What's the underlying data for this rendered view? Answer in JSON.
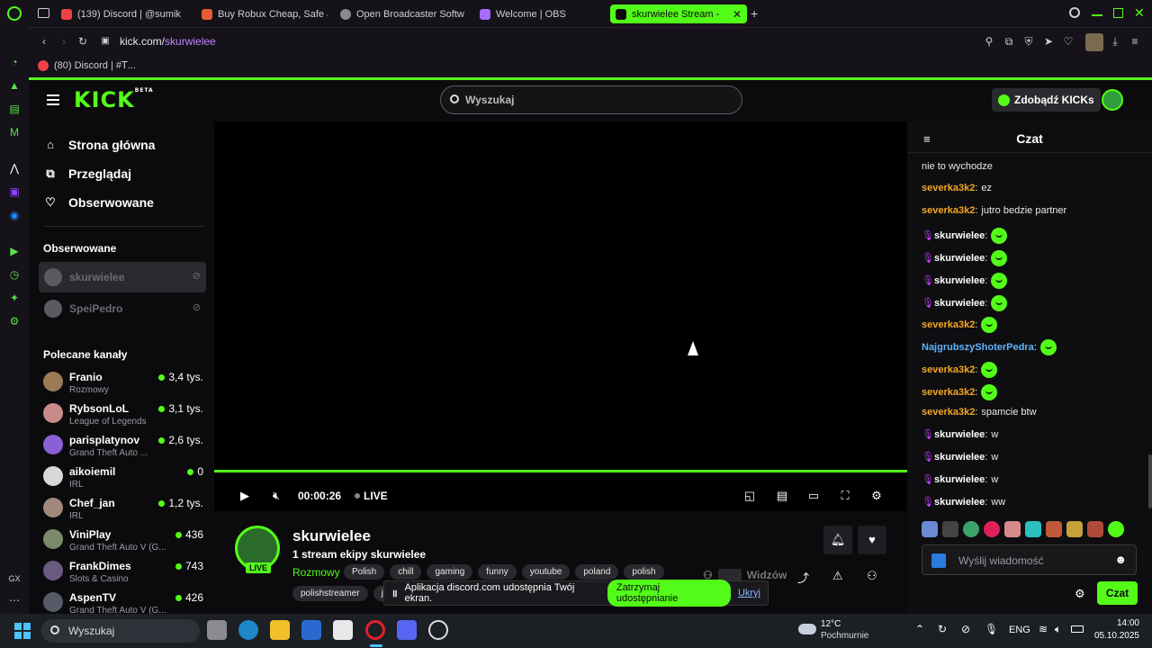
{
  "browser": {
    "tabs": [
      {
        "label": "(139) Discord | @sumik",
        "color": "#ed4245"
      },
      {
        "label": "Buy Robux Cheap, Safe &",
        "color": "#e65c2e"
      },
      {
        "label": "Open Broadcaster Softw",
        "color": "#8a8a8a"
      },
      {
        "label": "Welcome | OBS",
        "color": "#a96cff"
      },
      {
        "label": "skurwielee Stream -",
        "color": "#53fc18"
      }
    ],
    "new_tab": "+",
    "address": {
      "host": "kick.com/",
      "path": "skurwielee"
    },
    "bookmark": "(80) Discord | #ꓔ..."
  },
  "kick": {
    "logo": "KICK",
    "logo_badge": "BETA",
    "search_placeholder": "Wyszukaj",
    "get_kicks": "Zdobądź KICKs"
  },
  "sidebar": {
    "nav": [
      {
        "label": "Strona główna",
        "icon": "home-icon"
      },
      {
        "label": "Przeglądaj",
        "icon": "browse-icon"
      },
      {
        "label": "Obserwowane",
        "icon": "heart-icon"
      }
    ],
    "followed_title": "Obserwowane",
    "followed": [
      {
        "name": "skurwielee"
      },
      {
        "name": "SpeiPedro"
      }
    ],
    "recommended_title": "Polecane kanały",
    "recommended": [
      {
        "name": "Franio",
        "category": "Rozmowy",
        "viewers": "3,4 tys."
      },
      {
        "name": "RybsonLoL",
        "category": "League of Legends",
        "viewers": "3,1 tys."
      },
      {
        "name": "parisplatynov",
        "category": "Grand Theft Auto ...",
        "viewers": "2,6 tys."
      },
      {
        "name": "aikoiemil",
        "category": "IRL",
        "viewers": "0"
      },
      {
        "name": "Chef_jan",
        "category": "IRL",
        "viewers": "1,2 tys."
      },
      {
        "name": "ViniPlay",
        "category": "Grand Theft Auto V (G...",
        "viewers": "436"
      },
      {
        "name": "FrankDimes",
        "category": "Slots & Casino",
        "viewers": "743"
      },
      {
        "name": "AspenTV",
        "category": "Grand Theft Auto V (G...",
        "viewers": "426"
      }
    ]
  },
  "player": {
    "time": "00:00:26",
    "live": "LIVE"
  },
  "stream": {
    "streamer": "skurwielee",
    "live_badge": "LIVE",
    "title": "1 stream ekipy skurwielee",
    "category": "Rozmowy",
    "tags": [
      "Polish",
      "chill",
      "gaming",
      "funny",
      "youtube",
      "poland",
      "polish"
    ],
    "tags_row2": [
      "polishstreamer",
      "ju"
    ],
    "viewers_label": "Widzów"
  },
  "share_banner": {
    "text": "Aplikacja discord.com udostępnia Twój ekran.",
    "stop": "Zatrzymaj udostępnianie",
    "hide": "Ukryj"
  },
  "chat": {
    "title": "Czat",
    "top_line": "nie to wychodze",
    "messages": [
      {
        "user": "severka3k2",
        "color": "#f5a623",
        "text": "ez",
        "emote": false,
        "mic": false
      },
      {
        "user": "severka3k2",
        "color": "#f5a623",
        "text": "jutro bedzie partner",
        "emote": false,
        "mic": false
      },
      {
        "user": "skurwielee",
        "color": "#ffffff",
        "text": "",
        "emote": true,
        "mic": true
      },
      {
        "user": "skurwielee",
        "color": "#ffffff",
        "text": "",
        "emote": true,
        "mic": true
      },
      {
        "user": "skurwielee",
        "color": "#ffffff",
        "text": "",
        "emote": true,
        "mic": true
      },
      {
        "user": "skurwielee",
        "color": "#ffffff",
        "text": "",
        "emote": true,
        "mic": true
      },
      {
        "user": "severka3k2",
        "color": "#f5a623",
        "text": "",
        "emote": true,
        "mic": false
      },
      {
        "user": "NajgrubszyShoterPedra",
        "color": "#5fb3ff",
        "text": "",
        "emote": true,
        "mic": false
      },
      {
        "user": "severka3k2",
        "color": "#f5a623",
        "text": "",
        "emote": true,
        "mic": false
      },
      {
        "user": "severka3k2",
        "color": "#f5a623",
        "text": "",
        "emote": true,
        "mic": false
      },
      {
        "user": "severka3k2",
        "color": "#f5a623",
        "text": "spamcie btw",
        "emote": false,
        "mic": false
      },
      {
        "user": "skurwielee",
        "color": "#ffffff",
        "text": "w",
        "emote": false,
        "mic": true
      },
      {
        "user": "skurwielee",
        "color": "#ffffff",
        "text": "w",
        "emote": false,
        "mic": true
      },
      {
        "user": "skurwielee",
        "color": "#ffffff",
        "text": "w",
        "emote": false,
        "mic": true
      },
      {
        "user": "skurwielee",
        "color": "#ffffff",
        "text": "ww",
        "emote": false,
        "mic": true
      }
    ],
    "input_placeholder": "Wyślij wiadomość",
    "send_label": "Czat"
  },
  "taskbar": {
    "search": "Wyszukaj",
    "weather_temp": "12°C",
    "weather_desc": "Pochmurnie",
    "lang": "ENG",
    "time": "14:00",
    "date": "05.10.2025"
  },
  "colors": {
    "accent": "#53fc18",
    "bg": "#0b0b0d",
    "chrome": "#15121a"
  }
}
